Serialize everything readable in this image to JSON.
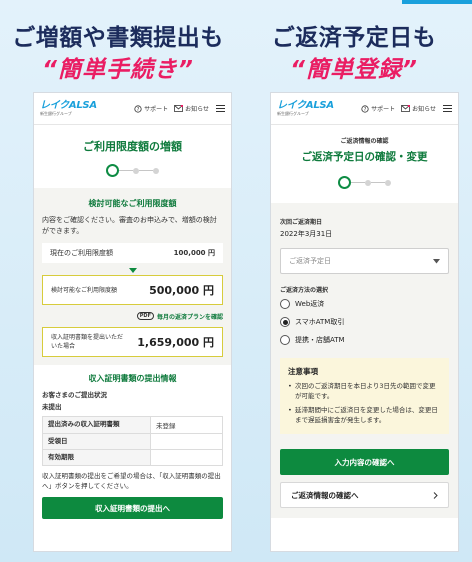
{
  "headlines": {
    "left": {
      "line1": "ご増額や書類提出も",
      "line2": "“簡単手続き”"
    },
    "right": {
      "line1": "ご返済予定日も",
      "line2": "“簡単登録”"
    }
  },
  "appbar": {
    "logo_text": "レイクALSA",
    "logo_sub": "新生銀行グループ",
    "support_label": "サポート",
    "notice_label": "お知らせ"
  },
  "left_screen": {
    "title": "ご利用限度額の増額",
    "available_card": {
      "title": "検討可能なご利用限度額",
      "note": "内容をご確認ください。審査のお申込みで、増額の検討ができます。",
      "current_label": "現在のご利用限度額",
      "current_value": "100,000 円",
      "possible_label": "検討可能なご利用限度額",
      "possible_value": "500,000 円",
      "pdf_badge": "PDF",
      "pdf_link": "毎月の返済プランを確認",
      "income_label": "収入証明書類を提出いただいた場合",
      "income_value": "1,659,000 円"
    },
    "docs_card": {
      "title": "収入証明書類の提出情報",
      "status_heading": "お客さまのご提出状況",
      "status_value": "未提出",
      "table": [
        {
          "k": "提出済みの収入証明書類",
          "v": "未登録"
        },
        {
          "k": "受領日",
          "v": ""
        },
        {
          "k": "有効期限",
          "v": ""
        }
      ],
      "note": "収入証明書類の提出をご希望の場合は、「収入証明書類の提出へ」ボタンを押してください。",
      "button": "収入証明書類の提出へ"
    }
  },
  "right_screen": {
    "breadcrumb": "ご返済情報の確認",
    "title": "ご返済予定日の確認・変更",
    "next_date_label": "次回ご返済期日",
    "next_date_value": "2022年3月31日",
    "select_placeholder": "ご返済予定日",
    "method_label": "ご返済方法の選択",
    "methods": [
      {
        "label": "Web返済",
        "selected": false
      },
      {
        "label": "スマホATM取引",
        "selected": true
      },
      {
        "label": "提携・店舗ATM",
        "selected": false
      }
    ],
    "notice_title": "注意事項",
    "notice_items": [
      "次回のご返済期日を本日より3日先の範囲で変更が可能です。",
      "延滞期間中にご返済日を変更した場合は、変更日まで遅延損害金が発生します。"
    ],
    "confirm_button": "入力内容の確認へ",
    "info_link": "ご返済情報の確認へ"
  },
  "colors": {
    "green": "#0d8a3f",
    "pink": "#ea1d63",
    "navy": "#1c2c5c",
    "brand_blue": "#19a0db"
  }
}
